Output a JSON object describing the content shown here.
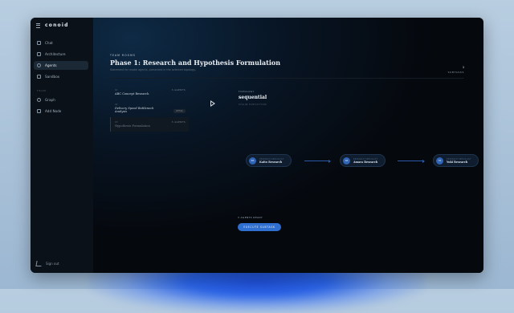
{
  "app": {
    "brand": "conoid"
  },
  "sidebar": {
    "items": [
      {
        "label": "Chat",
        "icon": "chat-icon"
      },
      {
        "label": "Architecture",
        "icon": "grid-icon"
      },
      {
        "label": "Agents",
        "icon": "users-icon",
        "active": true
      },
      {
        "label": "Sandbox",
        "icon": "box-icon"
      }
    ],
    "section_label": "TEAM",
    "team_items": [
      {
        "label": "Graph",
        "icon": "graph-icon"
      },
      {
        "label": "Add Node",
        "icon": "plus-icon"
      }
    ],
    "sign_out": "Sign out"
  },
  "header": {
    "eyebrow": "TEAM ROOMS",
    "title": "Phase 1: Research and Hypothesis Formulation",
    "subtitle": "Statement for model agents, presented in the selected topology.",
    "subtasks_count": "3",
    "subtasks_label": "SUBTASKS"
  },
  "tasks": [
    {
      "num": "01",
      "name": "ABC Concept Research",
      "meta": "3 AGENTS",
      "italic": false,
      "selected": false
    },
    {
      "num": "02",
      "name": "Delivery Speed Bottleneck Analysis",
      "badge": "DETAIL",
      "italic": true,
      "selected": false
    },
    {
      "num": "03",
      "name": "Hypothesis Formulation",
      "meta": "3 AGENTS",
      "italic": false,
      "selected": true
    }
  ],
  "topology": {
    "eyebrow": "TOPOLOGY",
    "value": "sequential",
    "sub": "CHAIN EXECUTION"
  },
  "agents": [
    {
      "role": "RESEARCH SPECIALIST",
      "name": "Kaito Research",
      "initials": "KR"
    },
    {
      "role": "RESEARCH SPECIALIST",
      "name": "Amara Research",
      "initials": "AR"
    },
    {
      "role": "RESEARCH SPECIALIST",
      "name": "Yuki Research",
      "initials": "YR"
    }
  ],
  "execute": {
    "label": "3 AGENTS READY",
    "button": "EXECUTE SUBTASK"
  },
  "colors": {
    "accent": "#2f6fd0",
    "window_bg": "#06090e",
    "sidebar_bg": "#0a1118"
  }
}
